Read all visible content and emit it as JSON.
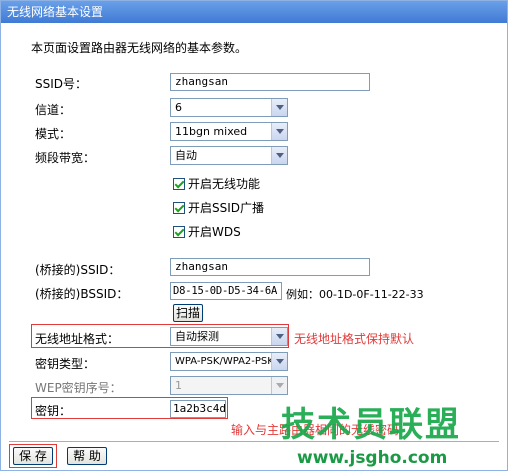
{
  "title": "无线网络基本设置",
  "description": "本页面设置路由器无线网络的基本参数。",
  "fields": {
    "ssid": {
      "label": "SSID号：",
      "value": "zhangsan"
    },
    "channel": {
      "label": "信道：",
      "value": "6"
    },
    "mode": {
      "label": "模式：",
      "value": "11bgn mixed"
    },
    "bandwidth": {
      "label": "频段带宽：",
      "value": "自动"
    },
    "bridged_ssid": {
      "label": "(桥接的)SSID：",
      "value": "zhangsan"
    },
    "bridged_bssid": {
      "label": "(桥接的)BSSID：",
      "value": "D8-15-0D-D5-34-6A",
      "example": "例如：00-1D-0F-11-22-33"
    },
    "mac_format": {
      "label": "无线地址格式：",
      "value": "自动探测",
      "note": "无线地址格式保持默认"
    },
    "key_type": {
      "label": "密钥类型：",
      "value": "WPA-PSK/WPA2-PSK"
    },
    "wep_index": {
      "label": "WEP密钥序号：",
      "value": "1"
    },
    "key": {
      "label": "密钥：",
      "value": "1a2b3c4d",
      "note": "输入与主路由器相同的无线密码"
    }
  },
  "checkboxes": {
    "wireless": "开启无线功能",
    "ssid_broadcast": "开启SSID广播",
    "wds": "开启WDS"
  },
  "buttons": {
    "scan": "扫描",
    "save": "保 存",
    "help": "帮 助"
  },
  "watermark": {
    "line1": "技术员联盟",
    "line2": "www.jsgho.com"
  },
  "colors": {
    "accent_red": "#e03a3a",
    "title_blue": "#3f7ad4",
    "watermark_green": "#19a84a"
  }
}
